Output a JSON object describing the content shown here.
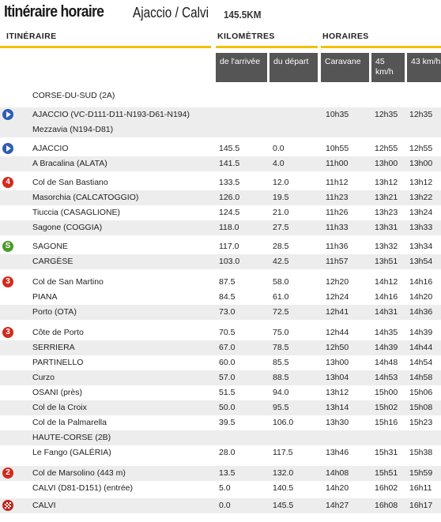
{
  "header": {
    "title": "Itinéraire horaire",
    "route": "Ajaccio / Calvi",
    "distance": "145.5KM"
  },
  "sections": {
    "itinerary": "ITINÉRAIRE",
    "km": "KILOMÈTRES",
    "times": "HORAIRES"
  },
  "columns": {
    "arrival": "de l'arrivée",
    "departure": "du départ",
    "caravan": "Caravane",
    "speed45": "45 km/h",
    "speed43": "43 km/h"
  },
  "colors": {
    "accent": "#f3c000",
    "header_bg": "#555555",
    "row_shade": "#ededed",
    "cat4": "#d42a1e",
    "sprint": "#4c9a2a",
    "start": "#2d5db8"
  },
  "rows": [
    {
      "name": "CORSE-DU-SUD (2A)",
      "arr": "",
      "dep": "",
      "car": "",
      "t45": "",
      "t43": "",
      "badge": null,
      "badge_text": ""
    },
    {
      "name": "AJACCIO (VC-D111-D11-N193-D61-N194)",
      "arr": "",
      "dep": "",
      "car": "10h35",
      "t45": "12h35",
      "t43": "12h35",
      "badge": "start",
      "badge_text": ""
    },
    {
      "name": "Mezzavia (N194-D81)",
      "arr": "",
      "dep": "",
      "car": "",
      "t45": "",
      "t43": "",
      "badge": null,
      "badge_text": ""
    },
    {
      "name": "AJACCIO",
      "arr": "145.5",
      "dep": "0.0",
      "car": "10h55",
      "t45": "12h55",
      "t43": "12h55",
      "badge": "start",
      "badge_text": ""
    },
    {
      "name": "A Bracalina (ALATA)",
      "arr": "141.5",
      "dep": "4.0",
      "car": "11h00",
      "t45": "13h00",
      "t43": "13h00",
      "badge": null,
      "badge_text": ""
    },
    {
      "name": "Col de San Bastiano",
      "arr": "133.5",
      "dep": "12.0",
      "car": "11h12",
      "t45": "13h12",
      "t43": "13h12",
      "badge": "climb",
      "badge_text": "4"
    },
    {
      "name": "Masorchia (CALCATOGGIO)",
      "arr": "126.0",
      "dep": "19.5",
      "car": "11h23",
      "t45": "13h21",
      "t43": "13h22",
      "badge": null,
      "badge_text": ""
    },
    {
      "name": "Tiuccia (CASAGLIONE)",
      "arr": "124.5",
      "dep": "21.0",
      "car": "11h26",
      "t45": "13h23",
      "t43": "13h24",
      "badge": null,
      "badge_text": ""
    },
    {
      "name": "Sagone (COGGIA)",
      "arr": "118.0",
      "dep": "27.5",
      "car": "11h33",
      "t45": "13h31",
      "t43": "13h33",
      "badge": null,
      "badge_text": ""
    },
    {
      "name": "SAGONE",
      "arr": "117.0",
      "dep": "28.5",
      "car": "11h36",
      "t45": "13h32",
      "t43": "13h34",
      "badge": "sprint",
      "badge_text": "S"
    },
    {
      "name": "CARGÈSE",
      "arr": "103.0",
      "dep": "42.5",
      "car": "11h57",
      "t45": "13h51",
      "t43": "13h54",
      "badge": null,
      "badge_text": ""
    },
    {
      "name": "Col de San Martino",
      "arr": "87.5",
      "dep": "58.0",
      "car": "12h20",
      "t45": "14h12",
      "t43": "14h16",
      "badge": "climb",
      "badge_text": "3"
    },
    {
      "name": "PIANA",
      "arr": "84.5",
      "dep": "61.0",
      "car": "12h24",
      "t45": "14h16",
      "t43": "14h20",
      "badge": null,
      "badge_text": ""
    },
    {
      "name": "Porto (OTA)",
      "arr": "73.0",
      "dep": "72.5",
      "car": "12h41",
      "t45": "14h31",
      "t43": "14h36",
      "badge": null,
      "badge_text": ""
    },
    {
      "name": "Côte de Porto",
      "arr": "70.5",
      "dep": "75.0",
      "car": "12h44",
      "t45": "14h35",
      "t43": "14h39",
      "badge": "climb",
      "badge_text": "3"
    },
    {
      "name": "SERRIERA",
      "arr": "67.0",
      "dep": "78.5",
      "car": "12h50",
      "t45": "14h39",
      "t43": "14h44",
      "badge": null,
      "badge_text": ""
    },
    {
      "name": "PARTINELLO",
      "arr": "60.0",
      "dep": "85.5",
      "car": "13h00",
      "t45": "14h48",
      "t43": "14h54",
      "badge": null,
      "badge_text": ""
    },
    {
      "name": "Curzo",
      "arr": "57.0",
      "dep": "88.5",
      "car": "13h04",
      "t45": "14h53",
      "t43": "14h58",
      "badge": null,
      "badge_text": ""
    },
    {
      "name": "OSANI (près)",
      "arr": "51.5",
      "dep": "94.0",
      "car": "13h12",
      "t45": "15h00",
      "t43": "15h06",
      "badge": null,
      "badge_text": ""
    },
    {
      "name": "Col de la Croix",
      "arr": "50.0",
      "dep": "95.5",
      "car": "13h14",
      "t45": "15h02",
      "t43": "15h08",
      "badge": null,
      "badge_text": ""
    },
    {
      "name": "Col de la Palmarella",
      "arr": "39.5",
      "dep": "106.0",
      "car": "13h30",
      "t45": "15h16",
      "t43": "15h23",
      "badge": null,
      "badge_text": ""
    },
    {
      "name": "HAUTE-CORSE (2B)",
      "arr": "",
      "dep": "",
      "car": "",
      "t45": "",
      "t43": "",
      "badge": null,
      "badge_text": ""
    },
    {
      "name": "Le Fango (GALÉRIA)",
      "arr": "28.0",
      "dep": "117.5",
      "car": "13h46",
      "t45": "15h31",
      "t43": "15h38",
      "badge": null,
      "badge_text": ""
    },
    {
      "name": "Col de Marsolino (443 m)",
      "arr": "13.5",
      "dep": "132.0",
      "car": "14h08",
      "t45": "15h51",
      "t43": "15h59",
      "badge": "climb",
      "badge_text": "2"
    },
    {
      "name": "CALVI (D81-D151) (entrée)",
      "arr": "5.0",
      "dep": "140.5",
      "car": "14h20",
      "t45": "16h02",
      "t43": "16h11",
      "badge": null,
      "badge_text": ""
    },
    {
      "name": "CALVI",
      "arr": "0.0",
      "dep": "145.5",
      "car": "14h27",
      "t45": "16h08",
      "t43": "16h17",
      "badge": "finish",
      "badge_text": ""
    }
  ]
}
